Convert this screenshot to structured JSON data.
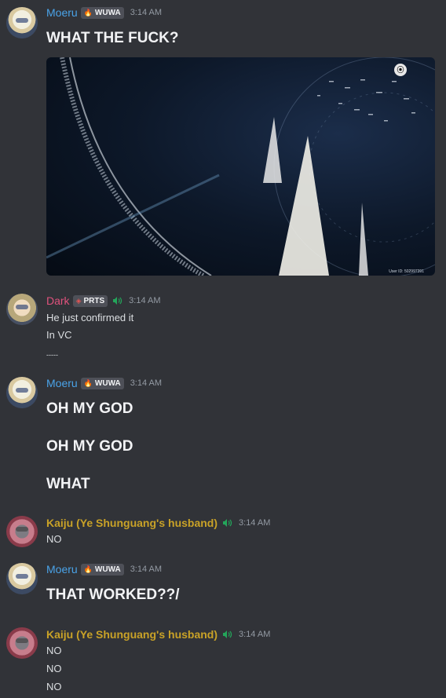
{
  "colors": {
    "background": "#313338",
    "moeru_name": "#4aa3e8",
    "dark_name": "#e0527d",
    "kaiju_name": "#c9a227",
    "speaking": "#23a55a"
  },
  "messages": [
    {
      "author": "Moeru",
      "tag": "WUWA",
      "tag_icon": "flame-icon",
      "time": "3:14 AM",
      "lines": [
        "WHAT THE FUCK?"
      ],
      "image": {
        "badge": "⦿",
        "id_text": "User ID: 502997391"
      }
    },
    {
      "author": "Dark",
      "tag": "PRTS",
      "tag_icon": "diamond-icon",
      "speaking": true,
      "time": "3:14 AM",
      "lines": [
        "He just confirmed it",
        "In VC",
        "-----"
      ]
    },
    {
      "author": "Moeru",
      "tag": "WUWA",
      "tag_icon": "flame-icon",
      "time": "3:14 AM",
      "lines": [
        "OH MY GOD",
        "OH MY GOD",
        "WHAT"
      ]
    },
    {
      "author": "Kaiju (Ye Shunguang's  husband)",
      "speaking": true,
      "time": "3:14 AM",
      "lines": [
        "NO"
      ]
    },
    {
      "author": "Moeru",
      "tag": "WUWA",
      "tag_icon": "flame-icon",
      "time": "3:14 AM",
      "lines": [
        "THAT WORKED??/"
      ]
    },
    {
      "author": "Kaiju (Ye Shunguang's  husband)",
      "speaking": true,
      "time": "3:14 AM",
      "lines": [
        "NO",
        "NO",
        "NO"
      ]
    }
  ]
}
